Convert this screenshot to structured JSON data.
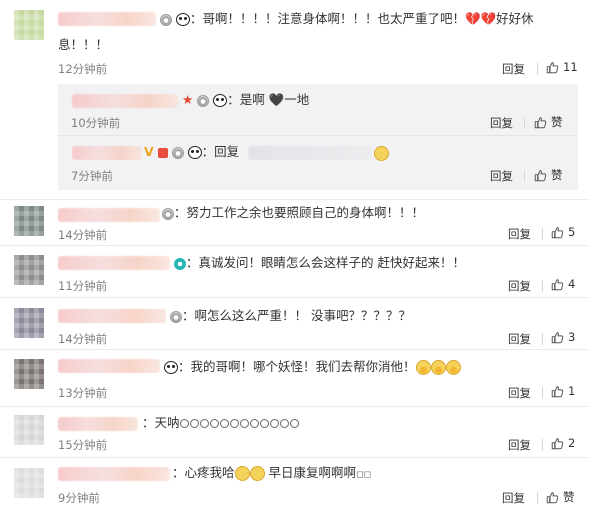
{
  "comments": [
    {
      "text_line1": "：哥啊！！！！注意身体啊！！！也太严重了吧！",
      "text_after_hearts": "好好休",
      "text_line2": "息！！！",
      "time": "12分钟前",
      "reply_label": "回复",
      "likes": "11",
      "sub_replies": [
        {
          "text": "：是啊 ",
          "text_after": "一地",
          "time": "10分钟前",
          "reply_label": "回复",
          "like_label": "赞"
        },
        {
          "text": "：回复",
          "time": "7分钟前",
          "reply_label": "回复",
          "like_label": "赞"
        }
      ]
    },
    {
      "text": "：努力工作之余也要照顾自己的身体啊！！！",
      "time": "14分钟前",
      "reply_label": "回复",
      "likes": "5"
    },
    {
      "text": "：真诚发问！眼睛怎么会这样子的 赶快好起来！！",
      "time": "11分钟前",
      "reply_label": "回复",
      "likes": "4"
    },
    {
      "text": "：啊怎么这么严重！！ 没事吧？？？？？",
      "time": "14分钟前",
      "reply_label": "回复",
      "likes": "3"
    },
    {
      "text": "：我的哥啊！哪个妖怪！我们去帮你消他！",
      "time": "13分钟前",
      "reply_label": "回复",
      "likes": "1"
    },
    {
      "text": "：天呐",
      "time": "15分钟前",
      "reply_label": "回复",
      "likes": "2"
    },
    {
      "text": "：心疼我哈",
      "text_after": " 早日康复啊啊啊",
      "time": "9分钟前",
      "reply_label": "回复",
      "like_label": "赞"
    }
  ],
  "icons": {
    "thumb": "thumbs-up-icon",
    "medal": "medal-icon",
    "panda": "panda-icon",
    "broken_heart": "broken-heart-icon"
  },
  "colors": {
    "separator": "#ececec",
    "sub_bg": "#f2f2f5",
    "time": "#808080"
  }
}
